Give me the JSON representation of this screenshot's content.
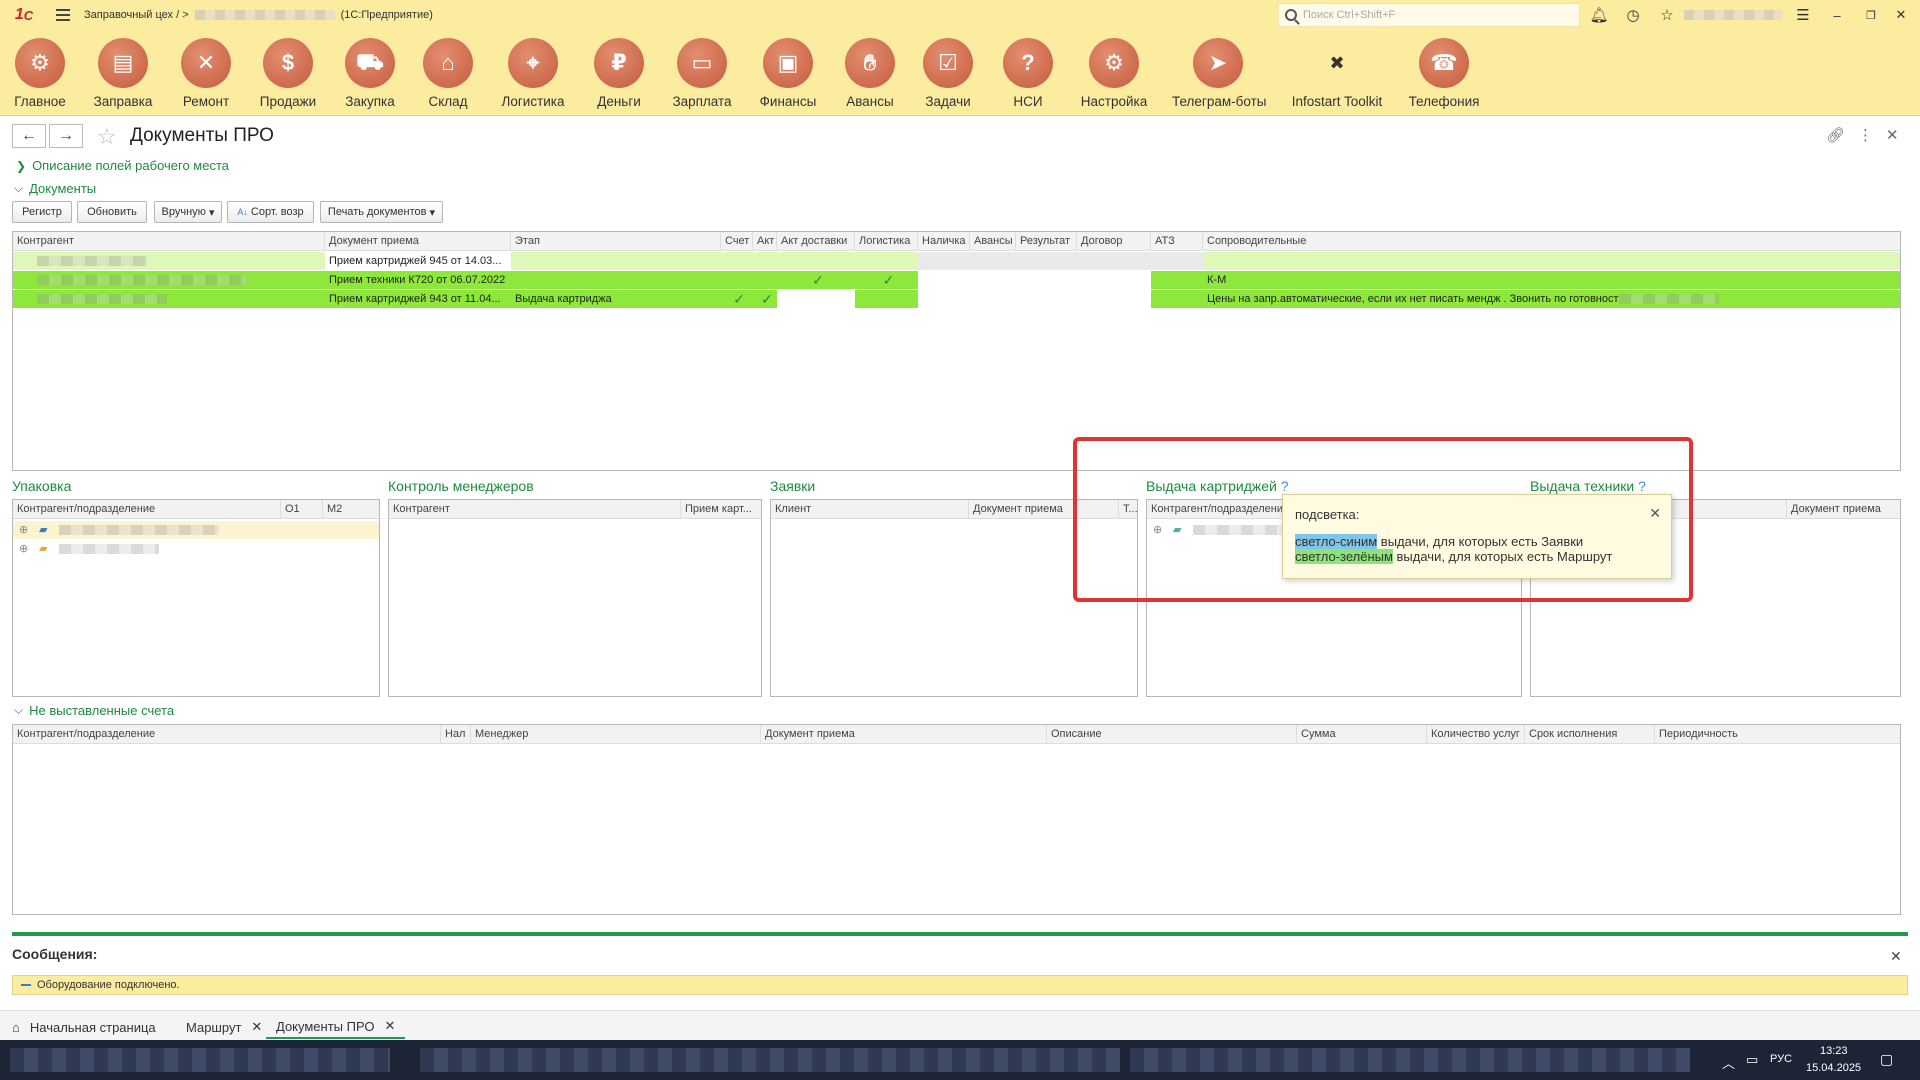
{
  "titlebar": {
    "app_name": "Заправочный цех /",
    "platform": "(1С:Предприятие)",
    "search_placeholder": "Поиск Ctrl+Shift+F"
  },
  "sections": [
    {
      "label": "Главное",
      "icon": "gears-icon"
    },
    {
      "label": "Заправка",
      "icon": "printer-icon"
    },
    {
      "label": "Ремонт",
      "icon": "tools-icon"
    },
    {
      "label": "Продажи",
      "icon": "sale-icon"
    },
    {
      "label": "Закупка",
      "icon": "cart-icon"
    },
    {
      "label": "Склад",
      "icon": "warehouse-icon"
    },
    {
      "label": "Логистика",
      "icon": "map-icon"
    },
    {
      "label": "Деньги",
      "icon": "money-bag-icon"
    },
    {
      "label": "Зарплата",
      "icon": "wallet-icon"
    },
    {
      "label": "Финансы",
      "icon": "briefcase-icon"
    },
    {
      "label": "Авансы",
      "icon": "hand-money-icon"
    },
    {
      "label": "Задачи",
      "icon": "checklist-icon"
    },
    {
      "label": "НСИ",
      "icon": "reference-book-icon"
    },
    {
      "label": "Настройка",
      "icon": "settings-icon"
    },
    {
      "label": "Телеграм-боты",
      "icon": "telegram-icon"
    },
    {
      "label": "Infostart Toolkit",
      "icon": "toolkit-icon"
    },
    {
      "label": "Телефония",
      "icon": "phone-icon"
    }
  ],
  "form": {
    "title": "Документы ПРО",
    "group_description": "Описание полей рабочего места",
    "group_documents": "Документы",
    "group_unbilled": "Не выставленные счета"
  },
  "buttons": {
    "register": "Регистр",
    "refresh": "Обновить",
    "manual": "Вручную",
    "sort": "Сорт. возр",
    "print": "Печать документов"
  },
  "main_table": {
    "columns": [
      "Контрагент",
      "Документ приема",
      "Этап",
      "Счет",
      "Акт",
      "Акт доставки",
      "Логистика",
      "Наличка",
      "Авансы",
      "Результат",
      "Договор",
      "АТЗ",
      "Сопроводительные"
    ],
    "rows": [
      {
        "doc": "Прием картриджей 945 от 14.03...",
        "stage": "",
        "comment": ""
      },
      {
        "doc": "Прием техники К720 от 06.07.2022",
        "stage": "",
        "comment": "К-М"
      },
      {
        "doc": "Прием картриджей 943 от 11.04...",
        "stage": "Выдача картриджа",
        "comment": "Цены на запр.автоматические, если их нет писать мендж . Звонить по готовност"
      }
    ]
  },
  "panels": {
    "packing": {
      "title": "Упаковка",
      "columns": [
        "Контрагент/подразделение",
        "О1",
        "М2"
      ]
    },
    "managers": {
      "title": "Контроль менеджеров",
      "columns": [
        "Контрагент",
        "Прием карт..."
      ]
    },
    "requests": {
      "title": "Заявки",
      "columns": [
        "Клиент",
        "Документ приема",
        "Т..."
      ]
    },
    "cartridges": {
      "title": "Выдача картриджей",
      "q": "?",
      "columns": [
        "Контрагент/подразделени"
      ]
    },
    "equipment": {
      "title": "Выдача техники",
      "q": "?",
      "columns": [
        "Объект",
        "Документ приема"
      ]
    }
  },
  "tooltip": {
    "title": "подсветка:",
    "blue_hl": "светло-синим",
    "blue_text": " выдачи, для которых есть Заявки",
    "green_hl": "светло-зелёным",
    "green_text": " выдачи, для которых есть Маршрут"
  },
  "unbilled_table": {
    "columns": [
      "Контрагент/подразделение",
      "Нал",
      "Менеджер",
      "Документ приема",
      "Описание",
      "Сумма",
      "Количество услуг",
      "Срок исполнения",
      "Периодичность"
    ]
  },
  "messages": {
    "title": "Сообщения:",
    "text": "Оборудование подключено."
  },
  "tabs": [
    {
      "label": "Начальная страница"
    },
    {
      "label": "Маршрут"
    },
    {
      "label": "Документы ПРО"
    }
  ],
  "taskbar": {
    "lang": "РУС",
    "time": "13:23",
    "date": "15.04.2025"
  },
  "colors": {
    "accent_green": "#1f8b3f",
    "toolbar_yellow": "#fbeca0",
    "row_green": "#8ee83c",
    "row_lightgreen": "#dff7b8"
  }
}
